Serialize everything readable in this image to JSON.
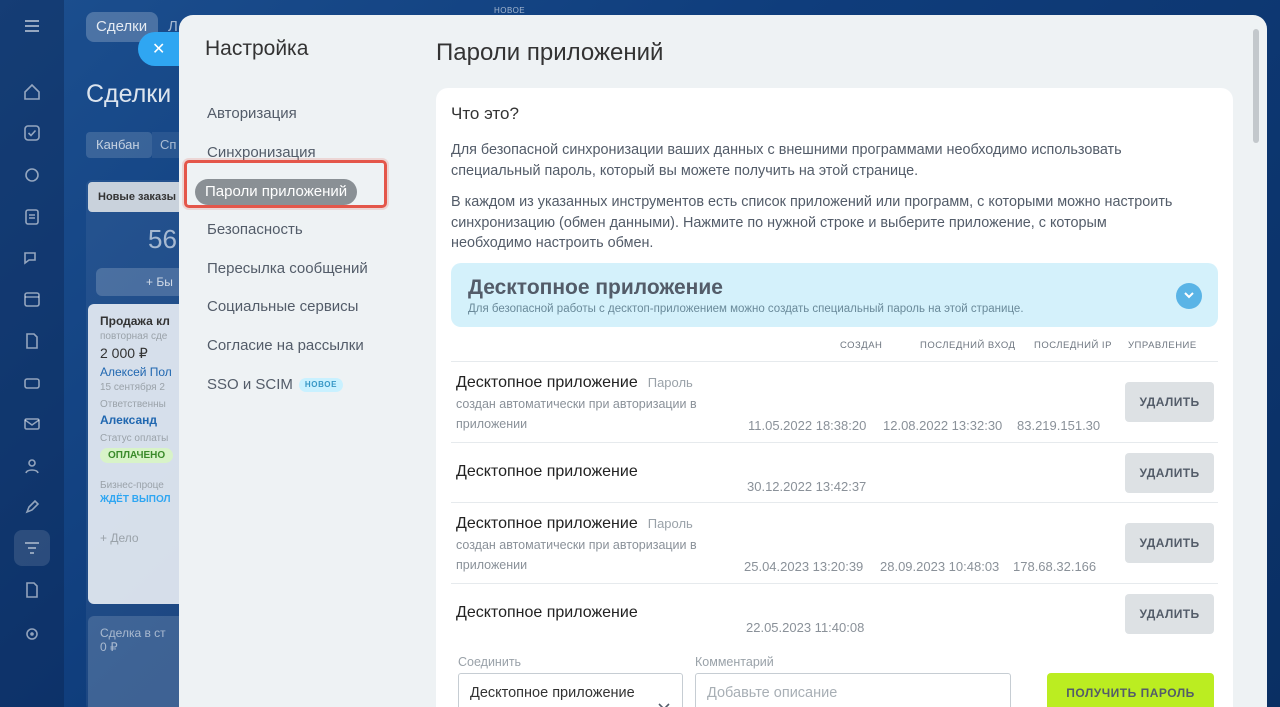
{
  "background": {
    "top_tab_active": "Сделки",
    "top_tab_partial": "Л",
    "new_label": "НОВОЕ",
    "title_partial": "Сделки",
    "view_kanban": "Канбан",
    "view_list_partial": "Сп",
    "column_name": "Новые заказы",
    "column_count_partial": "56",
    "add_button_partial": "+ Бы",
    "card": {
      "title_partial": "Продажа кл",
      "subtitle_partial": "повторная сде",
      "amount": "2 000 ₽",
      "contact_partial": "Алексей Пол",
      "date_partial": "15 сентября 2",
      "responsible_label_partial": "Ответственны",
      "responsible_partial": "Александ",
      "payment_label_partial": "Статус оплаты",
      "payment_badge_partial": "ОПЛАЧЕНО",
      "process_label_partial": "Бизнес-проце",
      "process_badge_partial": "ЖДЁТ ВЫПОЛ",
      "activity_partial": "+ Дело"
    },
    "card2_title_partial": "Сделка в ст",
    "card2_amount_partial": "0 ₽"
  },
  "settings": {
    "title": "Настройка",
    "nav": [
      {
        "label": "Авторизация",
        "active": false
      },
      {
        "label": "Синхронизация",
        "active": false
      },
      {
        "label": "Пароли приложений",
        "active": true
      },
      {
        "label": "Безопасность",
        "active": false
      },
      {
        "label": "Пересылка сообщений",
        "active": false
      },
      {
        "label": "Социальные сервисы",
        "active": false
      },
      {
        "label": "Согласие на рассылки",
        "active": false
      },
      {
        "label": "SSO и SCIM",
        "active": false,
        "badge": "НОВОЕ"
      }
    ]
  },
  "page": {
    "title": "Пароли приложений",
    "what_is_it": "Что это?",
    "description_1": "Для безопасной синхронизации ваших данных с внешними программами необходимо использовать специальный пароль, который вы можете получить на этой странице.",
    "description_2": "В каждом из указанных инструментов есть список приложений или программ, с которыми можно настроить синхронизацию (обмен данными). Нажмите по нужной строке и выберите приложение, с которым необходимо настроить обмен."
  },
  "section": {
    "title": "Десктопное приложение",
    "subtitle": "Для безопасной работы с десктоп-приложением можно создать специальный пароль на этой странице.",
    "columns": {
      "created": "СОЗДАН",
      "last_login": "ПОСЛЕДНИЙ ВХОД",
      "last_ip": "ПОСЛЕДНИЙ IP",
      "manage": "УПРАВЛЕНИЕ"
    },
    "rows": [
      {
        "name": "Десктопное приложение",
        "tag": "Пароль",
        "note": "создан автоматически при авторизации в приложении",
        "created": "11.05.2022 18:38:20",
        "last_login": "12.08.2022 13:32:30",
        "last_ip": "83.219.151.30",
        "action": "УДАЛИТЬ"
      },
      {
        "name": "Десктопное приложение",
        "tag": "",
        "note": "",
        "created": "30.12.2022 13:42:37",
        "last_login": "",
        "last_ip": "",
        "action": "УДАЛИТЬ"
      },
      {
        "name": "Десктопное приложение",
        "tag": "Пароль",
        "note": "создан автоматически при авторизации в приложении",
        "created": "25.04.2023 13:20:39",
        "last_login": "28.09.2023 10:48:03",
        "last_ip": "178.68.32.166",
        "action": "УДАЛИТЬ"
      },
      {
        "name": "Десктопное приложение",
        "tag": "",
        "note": "",
        "created": "22.05.2023 11:40:08",
        "last_login": "",
        "last_ip": "",
        "action": "УДАЛИТЬ"
      }
    ],
    "form": {
      "connect_label": "Соединить",
      "connect_value": "Десктопное приложение",
      "comment_label": "Комментарий",
      "comment_placeholder": "Добавьте описание",
      "submit": "ПОЛУЧИТЬ ПАРОЛЬ"
    }
  },
  "colors": {
    "accent_blue": "#2fa6f2",
    "highlight_red": "#e4564a",
    "section_bg": "#d4f1fb",
    "primary_green": "#bbed21"
  },
  "icons": {
    "close": "close-icon",
    "section_toggle": "chevron-down-icon",
    "select_chevron": "chevron-down-icon"
  }
}
